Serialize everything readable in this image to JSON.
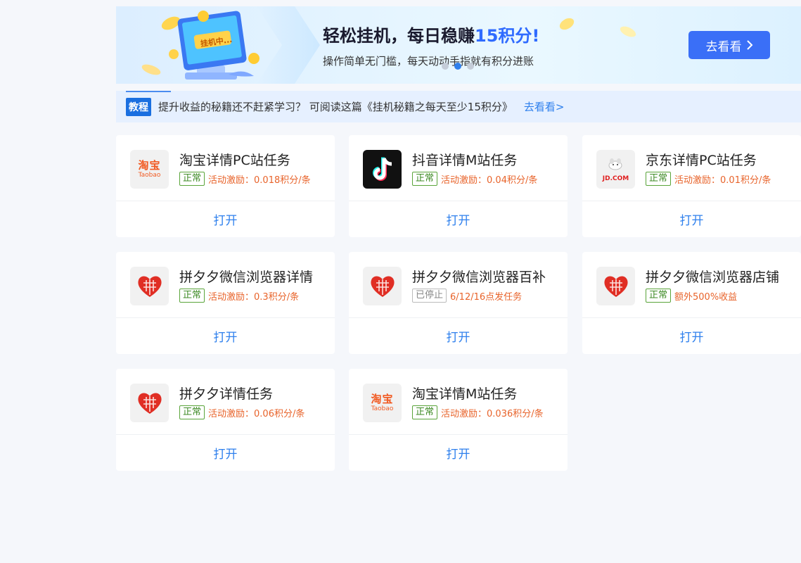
{
  "banner": {
    "art_label": "挂机中...",
    "title_main": "轻松挂机，每日稳赚",
    "title_highlight": "15积分!",
    "subtitle": "操作简单无门槛，每天动动手指就有积分进账",
    "button_label": "去看看",
    "carousel_total": 3,
    "carousel_active": 2,
    "colors": {
      "accent": "#2f6bff",
      "button": "#3a6ff7"
    }
  },
  "notice": {
    "tag": "教程",
    "text": "提升收益的秘籍还不赶紧学习？ 可阅读这篇《挂机秘籍之每天至少15积分》",
    "link": "去看看>"
  },
  "tasks": [
    {
      "name": "淘宝详情PC站任务",
      "status": "正常",
      "reward": "活动激励：0.018积分/条",
      "action": "打开",
      "logo_cn": "淘宝",
      "logo_en": "Taobao",
      "icon": "taobao-icon"
    },
    {
      "name": "抖音详情M站任务",
      "status": "正常",
      "reward": "活动激励：0.04积分/条",
      "action": "打开",
      "icon": "tiktok-icon"
    },
    {
      "name": "京东详情PC站任务",
      "status": "正常",
      "reward": "活动激励：0.01积分/条",
      "action": "打开",
      "logo_en": "JD.COM",
      "icon": "jd-icon"
    },
    {
      "name": "拼夕夕微信浏览器详情",
      "status": "正常",
      "reward": "活动激励：0.3积分/条",
      "action": "打开",
      "icon": "pinduoduo-icon"
    },
    {
      "name": "拼夕夕微信浏览器百补",
      "status": "已停止",
      "reward": "6/12/16点发任务",
      "action": "打开",
      "icon": "pinduoduo-icon"
    },
    {
      "name": "拼夕夕微信浏览器店铺",
      "status": "正常",
      "reward": "额外500%收益",
      "action": "打开",
      "icon": "pinduoduo-icon"
    },
    {
      "name": "拼夕夕详情任务",
      "status": "正常",
      "reward": "活动激励：0.06积分/条",
      "action": "打开",
      "icon": "pinduoduo-icon"
    },
    {
      "name": "淘宝详情M站任务",
      "status": "正常",
      "reward": "活动激励：0.036积分/条",
      "action": "打开",
      "logo_cn": "淘宝",
      "logo_en": "Taobao",
      "icon": "taobao-icon"
    }
  ]
}
